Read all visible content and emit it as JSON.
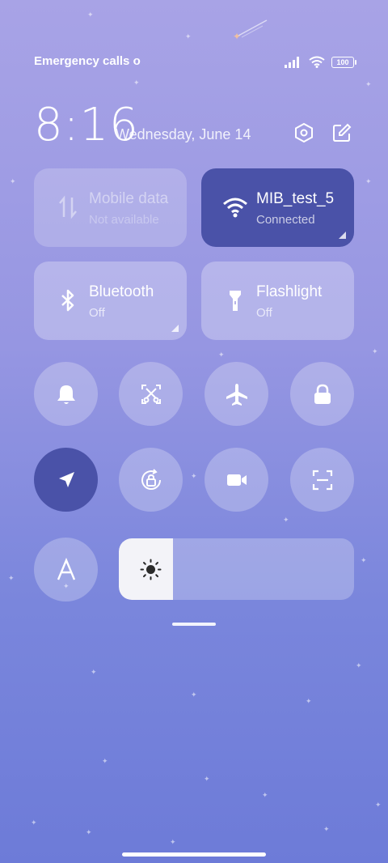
{
  "status_bar": {
    "carrier_text": "Emergency calls o",
    "battery": "100",
    "signal_icon": "signal-bars-icon",
    "wifi_icon": "wifi-icon"
  },
  "header": {
    "time": "8:16",
    "date": "Wednesday, June 14",
    "settings_icon": "settings-hexagon-icon",
    "edit_icon": "edit-icon"
  },
  "tiles": {
    "mobile_data": {
      "title": "Mobile data",
      "subtitle": "Not available",
      "state": "disabled"
    },
    "wifi": {
      "title": "MIB_test_5",
      "subtitle": "Connected",
      "state": "on"
    },
    "bluetooth": {
      "title": "Bluetooth",
      "subtitle": "Off",
      "state": "off"
    },
    "flashlight": {
      "title": "Flashlight",
      "subtitle": "Off",
      "state": "off"
    }
  },
  "toggles": [
    {
      "name": "bell-icon",
      "active": false
    },
    {
      "name": "screenshot-icon",
      "active": false
    },
    {
      "name": "airplane-icon",
      "active": false
    },
    {
      "name": "lock-icon",
      "active": false
    },
    {
      "name": "location-icon",
      "active": true
    },
    {
      "name": "rotation-lock-icon",
      "active": false
    },
    {
      "name": "video-camera-icon",
      "active": false
    },
    {
      "name": "scan-icon",
      "active": false
    },
    {
      "name": "font-size-icon",
      "active": false
    }
  ],
  "brightness": {
    "level": 0.23,
    "icon": "sun-icon"
  },
  "colors": {
    "active": "#4a52a8",
    "tile_bg": "rgba(255,255,255,0.28)"
  }
}
